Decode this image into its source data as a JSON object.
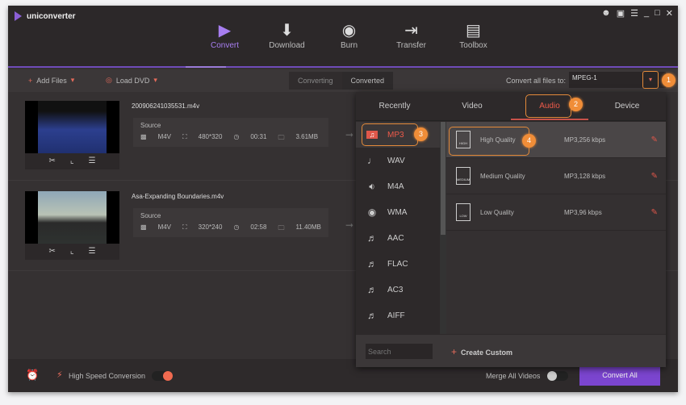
{
  "app": {
    "title": "uniconverter",
    "window_controls": [
      "user-icon",
      "feedback-icon",
      "menu-icon",
      "minimize-icon",
      "maximize-icon",
      "close-icon"
    ]
  },
  "nav": [
    {
      "label": "Convert",
      "icon": "convert-icon",
      "active": true
    },
    {
      "label": "Download",
      "icon": "download-icon"
    },
    {
      "label": "Burn",
      "icon": "burn-icon"
    },
    {
      "label": "Transfer",
      "icon": "transfer-icon"
    },
    {
      "label": "Toolbox",
      "icon": "toolbox-icon"
    }
  ],
  "toolbar": {
    "add_files": "Add Files",
    "load_dvd": "Load DVD",
    "tabs": [
      "Converting",
      "Converted"
    ],
    "convert_all_label": "Convert all files to:",
    "convert_all_value": "MPEG-1"
  },
  "files": [
    {
      "name": "200906241035531.m4v",
      "source_label": "Source",
      "format": "M4V",
      "resolution": "480*320",
      "duration": "00:31",
      "size": "3.61MB"
    },
    {
      "name": "Asa-Expanding Boundaries.m4v",
      "source_label": "Source",
      "format": "M4V",
      "resolution": "320*240",
      "duration": "02:58",
      "size": "11.40MB"
    }
  ],
  "popup": {
    "tabs": [
      "Recently",
      "Video",
      "Audio",
      "Device"
    ],
    "active_tab": "Audio",
    "formats": [
      "MP3",
      "WAV",
      "M4A",
      "WMA",
      "AAC",
      "FLAC",
      "AC3",
      "AIFF"
    ],
    "selected_format": "MP3",
    "qualities": [
      {
        "name": "High Quality",
        "detail": "MP3,256 kbps",
        "badge": "HIGH"
      },
      {
        "name": "Medium Quality",
        "detail": "MP3,128 kbps",
        "badge": "MEDIUM"
      },
      {
        "name": "Low Quality",
        "detail": "MP3,96 kbps",
        "badge": "LOW"
      }
    ],
    "search_placeholder": "Search",
    "create_custom": "Create Custom"
  },
  "steps": [
    "1",
    "2",
    "3",
    "4"
  ],
  "bottom": {
    "high_speed": "High Speed Conversion",
    "high_speed_on": true,
    "merge": "Merge All Videos",
    "merge_on": false,
    "convert_all": "Convert All"
  },
  "colors": {
    "accent": "#8b5fd6",
    "highlight": "#ee5a4a",
    "callout": "#f08d38"
  }
}
